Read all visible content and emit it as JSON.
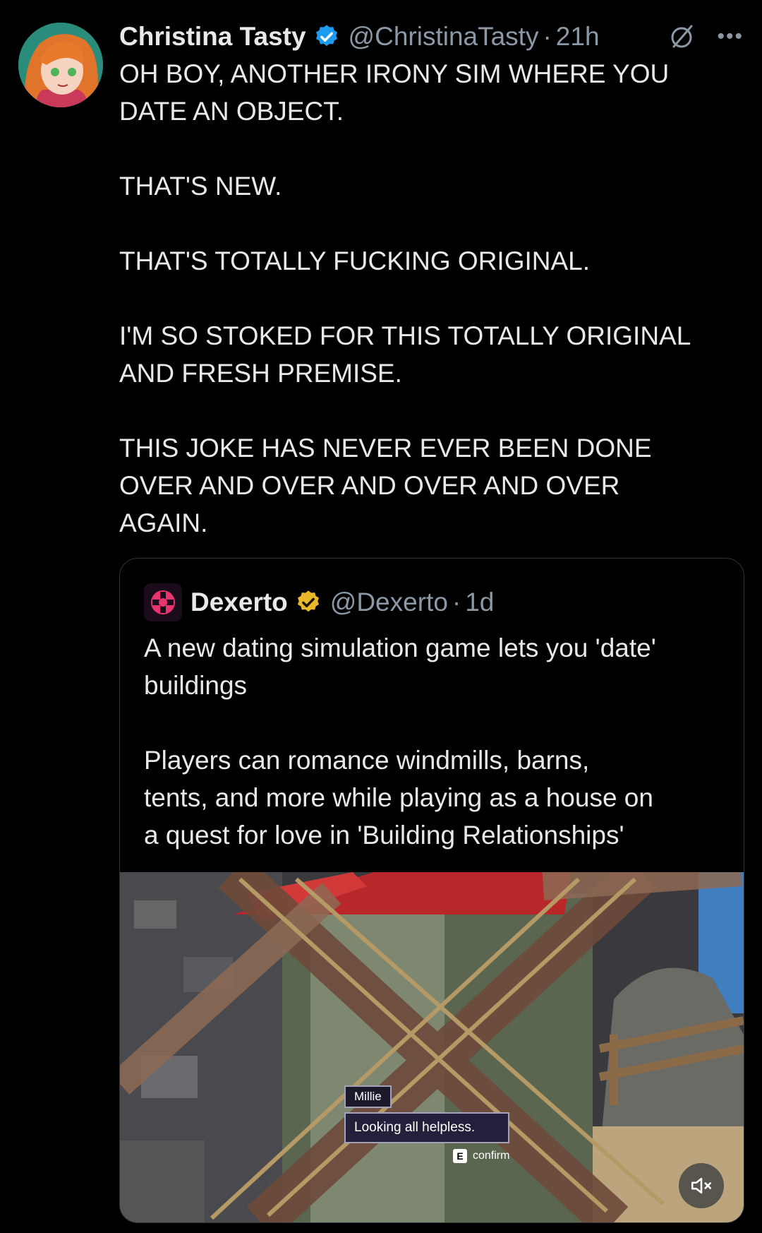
{
  "tweet": {
    "author_name": "Christina Tasty",
    "handle": "@ChristinaTasty",
    "separator": "·",
    "time": "21h",
    "text": "OH BOY, ANOTHER IRONY SIM WHERE YOU\nDATE AN OBJECT.\n\nTHAT'S NEW.\n\nTHAT'S TOTALLY FUCKING ORIGINAL.\n\nI'M SO STOKED FOR THIS TOTALLY ORIGINAL\nAND FRESH PREMISE.\n\nTHIS JOKE HAS NEVER EVER BEEN DONE\nOVER AND OVER AND OVER AND OVER\nAGAIN.",
    "more_icon": "•••"
  },
  "quote": {
    "author_name": "Dexerto",
    "handle": "@Dexerto",
    "separator": "·",
    "time": "1d",
    "text": "A new dating simulation game lets you 'date'\nbuildings\n\nPlayers can romance windmills, barns,\ntents, and more while playing as a house on\na quest for love in 'Building Relationships'",
    "media": {
      "dialog_name": "Millie",
      "dialog_text": "Looking all helpless.",
      "confirm_key": "E",
      "confirm_label": "confirm"
    }
  },
  "colors": {
    "background": "#000000",
    "text": "#e7e9ea",
    "secondary": "#8b98a5",
    "verified_blue": "#1d9bf0",
    "verified_gold": "#e8b829",
    "border": "#2f3336"
  },
  "icons": {
    "verified": "verified-badge-icon",
    "gold_badge": "gold-verified-badge-icon",
    "grok": "grok-icon",
    "more": "more-icon",
    "mute": "mute-icon"
  }
}
